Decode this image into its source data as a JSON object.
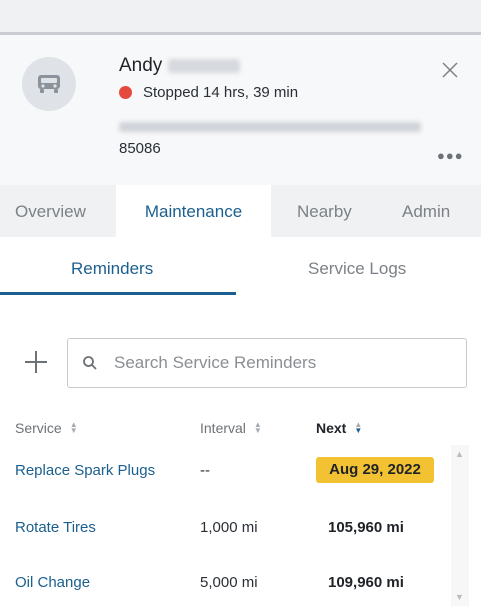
{
  "vehicle": {
    "driver_first_name": "Andy",
    "status_text": "Stopped 14 hrs, 39 min",
    "zip": "85086",
    "status_color": "#e5493d"
  },
  "tabs": [
    {
      "label": "Overview"
    },
    {
      "label": "Maintenance"
    },
    {
      "label": "Nearby"
    },
    {
      "label": "Admin"
    }
  ],
  "subtabs": [
    {
      "label": "Reminders"
    },
    {
      "label": "Service Logs"
    }
  ],
  "search": {
    "placeholder": "Search Service Reminders"
  },
  "table": {
    "headers": {
      "service": "Service",
      "interval": "Interval",
      "next": "Next"
    },
    "rows": [
      {
        "service": "Replace Spark Plugs",
        "interval": "--",
        "next": "Aug 29, 2022",
        "highlight": "#f2c232"
      },
      {
        "service": "Rotate Tires",
        "interval": "1,000 mi",
        "next": "105,960 mi"
      },
      {
        "service": "Oil Change",
        "interval": "5,000 mi",
        "next": "109,960 mi"
      }
    ]
  },
  "colors": {
    "accent": "#1b5f8f",
    "badge": "#f2c232"
  },
  "icons": {
    "avatar": "car-icon",
    "close": "close-icon",
    "more": "more-icon",
    "add": "plus-icon",
    "search": "search-icon"
  }
}
